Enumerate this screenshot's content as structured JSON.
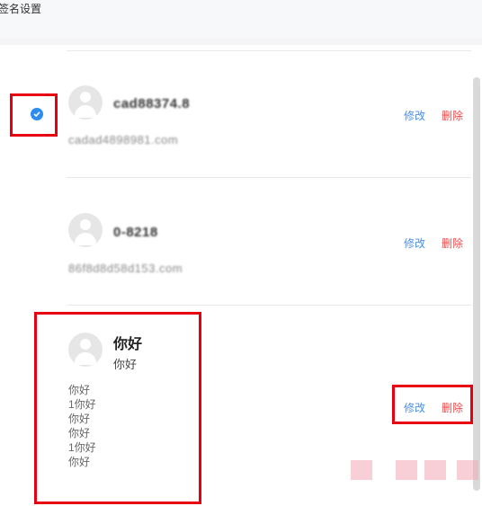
{
  "header": {
    "title": "签名设置"
  },
  "signatures": [
    {
      "name": "cad88374.8",
      "email": "cadad4898981.com",
      "selected": true,
      "edit_label": "修改",
      "delete_label": "删除"
    },
    {
      "name": "0-8218",
      "email": "86f8d8d58d153.com",
      "selected": false,
      "edit_label": "修改",
      "delete_label": "删除"
    },
    {
      "name": "你好",
      "subtitle": "你好",
      "lines": [
        "你好",
        "1你好",
        "你好",
        "你好",
        "1你好",
        "你好"
      ],
      "selected": false,
      "edit_label": "修改",
      "delete_label": "删除"
    }
  ],
  "colors": {
    "accent": "#2d8cf0",
    "edit": "#4a8fe7",
    "delete": "#ef4b4b",
    "highlight": "#e60012"
  }
}
